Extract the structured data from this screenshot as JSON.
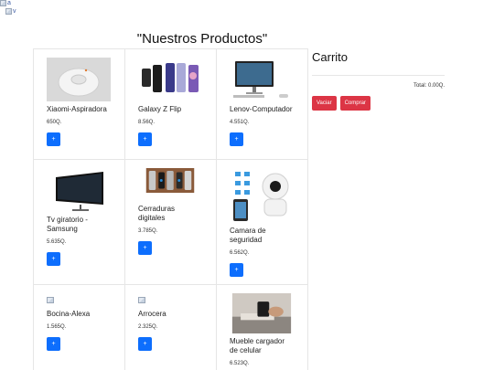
{
  "page": {
    "broken_img_alt_1": "a",
    "broken_img_alt_2": "v",
    "heading": "\"Nuestros Productos\""
  },
  "products": [
    {
      "name": "Xiaomi-Aspiradora",
      "price": "650Q.",
      "add_label": "+",
      "image": "robot-vacuum-image"
    },
    {
      "name": "Galaxy Z Flip",
      "price": "8.56Q.",
      "add_label": "+",
      "image": "foldable-phones-image"
    },
    {
      "name": "Lenov-Computador",
      "price": "4.551Q.",
      "add_label": "+",
      "image": "desktop-computer-image"
    },
    {
      "name": "Tv giratorio -Samsung",
      "price": "5.635Q.",
      "add_label": "+",
      "image": "tv-image"
    },
    {
      "name": "Cerraduras digitales",
      "price": "3.785Q.",
      "add_label": "+",
      "image": "digital-locks-image"
    },
    {
      "name": "Camara de seguridad",
      "price": "6.562Q.",
      "add_label": "+",
      "image": "security-camera-image"
    },
    {
      "name": "Bocina-Alexa",
      "price": "1.565Q.",
      "add_label": "+",
      "image": "broken-image"
    },
    {
      "name": "Arrocera",
      "price": "2.325Q.",
      "add_label": "+",
      "image": "broken-image"
    },
    {
      "name": "Mueble cargador de celular",
      "price": "6.523Q.",
      "add_label": "+",
      "image": "charging-furniture-image"
    }
  ],
  "cart": {
    "title": "Carrito",
    "total": "Total: 0.00Q.",
    "clear_label": "Vaciar",
    "buy_label": "Comprar"
  },
  "colors": {
    "primary": "#0d6efd",
    "danger": "#dc3545"
  }
}
